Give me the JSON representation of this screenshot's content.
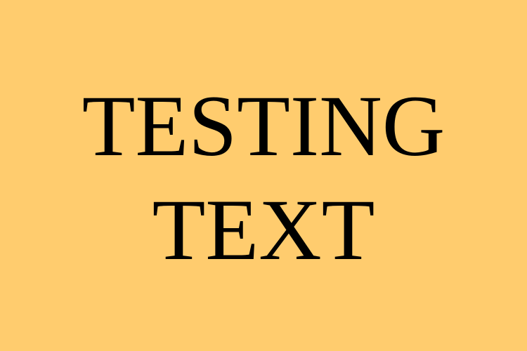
{
  "background_color": "#ffcc6e",
  "text_color": "#000000",
  "lines": [
    "TESTING",
    "TEXT"
  ]
}
